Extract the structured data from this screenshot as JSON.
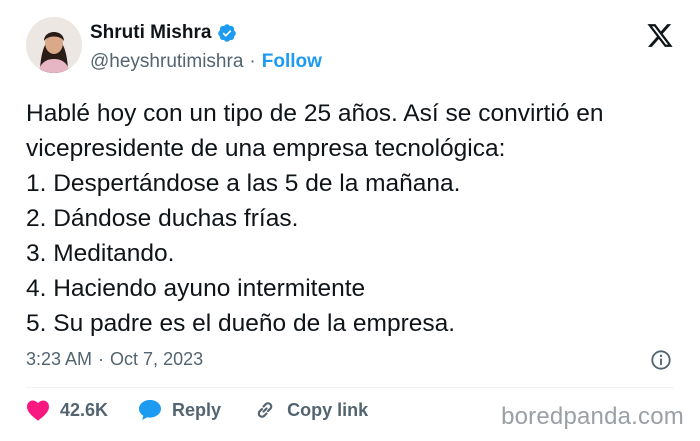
{
  "author": {
    "name": "Shruti Mishra",
    "handle": "@heyshrutimishra",
    "separator": "·",
    "follow_label": "Follow",
    "verified_icon": "verified-badge-icon"
  },
  "tweet": {
    "lines": [
      "Hablé hoy con un tipo de 25 años. Así se convirtió en",
      "vicepresidente de una empresa tecnológica:",
      "1. Despertándose a las 5 de la mañana.",
      "2. Dándose duchas frías.",
      "3. Meditando.",
      "4. Haciendo ayuno intermitente",
      "5. Su padre es el dueño de la empresa."
    ],
    "time": "3:23 AM",
    "separator": "·",
    "date": "Oct 7, 2023"
  },
  "actions": {
    "like_count": "42.6K",
    "reply_label": "Reply",
    "copy_link_label": "Copy link"
  },
  "watermark": "boredpanda.com",
  "colors": {
    "accent": "#1d9bf0",
    "like": "#f91880",
    "text": "#0f1419",
    "secondary": "#536471"
  }
}
